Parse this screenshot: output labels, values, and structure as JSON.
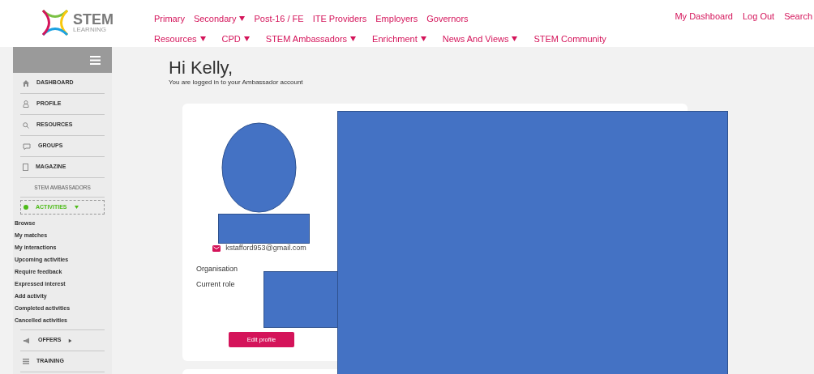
{
  "logo": {
    "title": "STEM",
    "subtitle": "LEARNING"
  },
  "nav_top": [
    {
      "label": "Primary",
      "has_menu": false
    },
    {
      "label": "Secondary",
      "has_menu": true
    },
    {
      "label": "Post-16 / FE",
      "has_menu": false
    },
    {
      "label": "ITE Providers",
      "has_menu": false
    },
    {
      "label": "Employers",
      "has_menu": false
    },
    {
      "label": "Governors",
      "has_menu": false
    }
  ],
  "nav_bottom": [
    {
      "label": "Resources",
      "has_menu": true
    },
    {
      "label": "CPD",
      "has_menu": true
    },
    {
      "label": "STEM Ambassadors",
      "has_menu": true
    },
    {
      "label": "Enrichment",
      "has_menu": true
    },
    {
      "label": "News And Views",
      "has_menu": true
    },
    {
      "label": "STEM Community",
      "has_menu": false
    }
  ],
  "account_links": [
    "My Dashboard",
    "Log Out",
    "Search"
  ],
  "sidebar": {
    "items": [
      {
        "kind": "home",
        "label": "DASHBOARD"
      },
      {
        "kind": "person",
        "label": "PROFILE"
      },
      {
        "kind": "search",
        "label": "RESOURCES"
      },
      {
        "kind": "chat",
        "label": "GROUPS"
      },
      {
        "kind": "page",
        "label": "MAGAZINE"
      },
      {
        "kind": "section",
        "label": "STEM AMBASSADORS"
      },
      {
        "kind": "dot",
        "label": "ACTIVITIES",
        "expanded": true,
        "selected": true,
        "children": [
          {
            "label": "Browse"
          },
          {
            "label": "My matches"
          },
          {
            "label": "My interactions"
          },
          {
            "label": "Upcoming activities"
          },
          {
            "label": "Require feedback"
          },
          {
            "label": "Expressed interest"
          },
          {
            "label": "Add activity"
          },
          {
            "label": "Completed activities"
          },
          {
            "label": "Cancelled activities"
          }
        ]
      },
      {
        "kind": "megaphone",
        "label": "OFFERS",
        "expanded": false,
        "selected": false
      },
      {
        "kind": "list",
        "label": "TRAINING"
      }
    ]
  },
  "greeting": {
    "title": "Hi Kelly,",
    "subtitle": "You are logged in to your Ambassador account"
  },
  "profile": {
    "email": "kstafford953@gmail.com",
    "fields": [
      "Organisation",
      "Current role"
    ],
    "button": "Edit profile"
  }
}
